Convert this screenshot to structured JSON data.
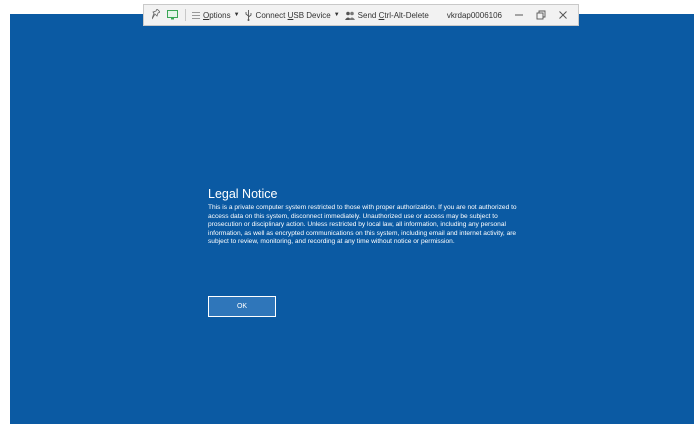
{
  "toolbar": {
    "options_label": "Options",
    "options_hotkey": "O",
    "options_rest": "ptions",
    "usb_prefix": "Connect ",
    "usb_hotkey": "U",
    "usb_rest": "SB Device",
    "ctrl_prefix": "Send ",
    "ctrl_hotkey": "C",
    "ctrl_rest": "trl-Alt-Delete",
    "host_name": "vkrdap0006106",
    "icons": [
      "pin-icon",
      "monitor-icon",
      "menu-icon",
      "usb-icon",
      "ctrl-alt-del-icon",
      "minimize-icon",
      "restore-icon",
      "close-icon"
    ]
  },
  "notice": {
    "title": "Legal Notice",
    "body": "This is a private computer system restricted to those with proper authorization. If you are not authorized to access data on this system, disconnect immediately. Unauthorized use or access may be subject to prosecution or disciplinary action. Unless restricted by local law, all information, including any personal information, as well as encrypted communications on this system, including email and internet activity, are subject to review, monitoring, and recording at any time without notice or permission.",
    "ok_label": "OK"
  },
  "colors": {
    "desktop_background": "#0b5aa3",
    "toolbar_background": "#f2f2f2",
    "monitor_icon": "#3aa655"
  }
}
